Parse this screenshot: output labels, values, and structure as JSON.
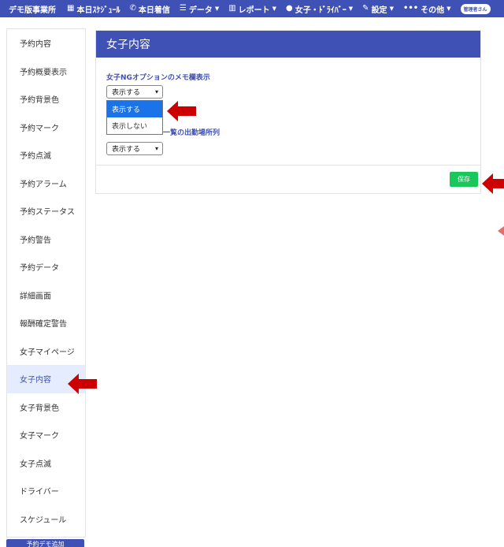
{
  "nav": {
    "brand": "デモ版事業所",
    "items": [
      {
        "icon": "calendar-icon",
        "glyph": "▦",
        "label": "本日ｽｹｼﾞｭｰﾙ",
        "caret": false
      },
      {
        "icon": "phone-icon",
        "glyph": "✆",
        "label": "本日着信",
        "caret": false
      },
      {
        "icon": "database-icon",
        "glyph": "☰",
        "label": "データ",
        "caret": true
      },
      {
        "icon": "chart-icon",
        "glyph": "▥",
        "label": "レポート",
        "caret": true
      },
      {
        "icon": "person-icon",
        "glyph": "●",
        "label": "女子・ﾄﾞﾗｲﾊﾞｰ",
        "caret": true
      },
      {
        "icon": "wrench-icon",
        "glyph": "✎",
        "label": "設定",
        "caret": true
      },
      {
        "icon": "more-icon",
        "glyph": "•••",
        "label": "その他",
        "caret": true
      }
    ],
    "user_badge": "管理者さん"
  },
  "sidebar": {
    "items": [
      {
        "label": "予約内容"
      },
      {
        "label": "予約概要表示"
      },
      {
        "label": "予約背景色"
      },
      {
        "label": "予約マーク"
      },
      {
        "label": "予約点滅"
      },
      {
        "label": "予約アラーム"
      },
      {
        "label": "予約ステータス"
      },
      {
        "label": "予約警告"
      },
      {
        "label": "予約データ"
      },
      {
        "label": "詳細画面"
      },
      {
        "label": "報酬確定警告"
      },
      {
        "label": "女子マイページ"
      },
      {
        "label": "女子内容",
        "active": true
      },
      {
        "label": "女子背景色"
      },
      {
        "label": "女子マーク"
      },
      {
        "label": "女子点滅"
      },
      {
        "label": "ドライバー"
      },
      {
        "label": "スケジュール"
      }
    ],
    "bottom_button": "予約デモ追加"
  },
  "card": {
    "title": "女子内容",
    "field1": {
      "label": "女子NGオプションのメモ欄表示",
      "value": "表示する",
      "options": [
        "表示する",
        "表示しない"
      ],
      "selected_option": "表示する"
    },
    "field2": {
      "label_visible": "一覧の出勤場所列",
      "value": "表示する"
    },
    "save_label": "保存"
  },
  "colors": {
    "primary": "#3f51b5",
    "save": "#19c75a",
    "arrow": "#cc0000",
    "dropdown_highlight": "#1a73e8"
  }
}
